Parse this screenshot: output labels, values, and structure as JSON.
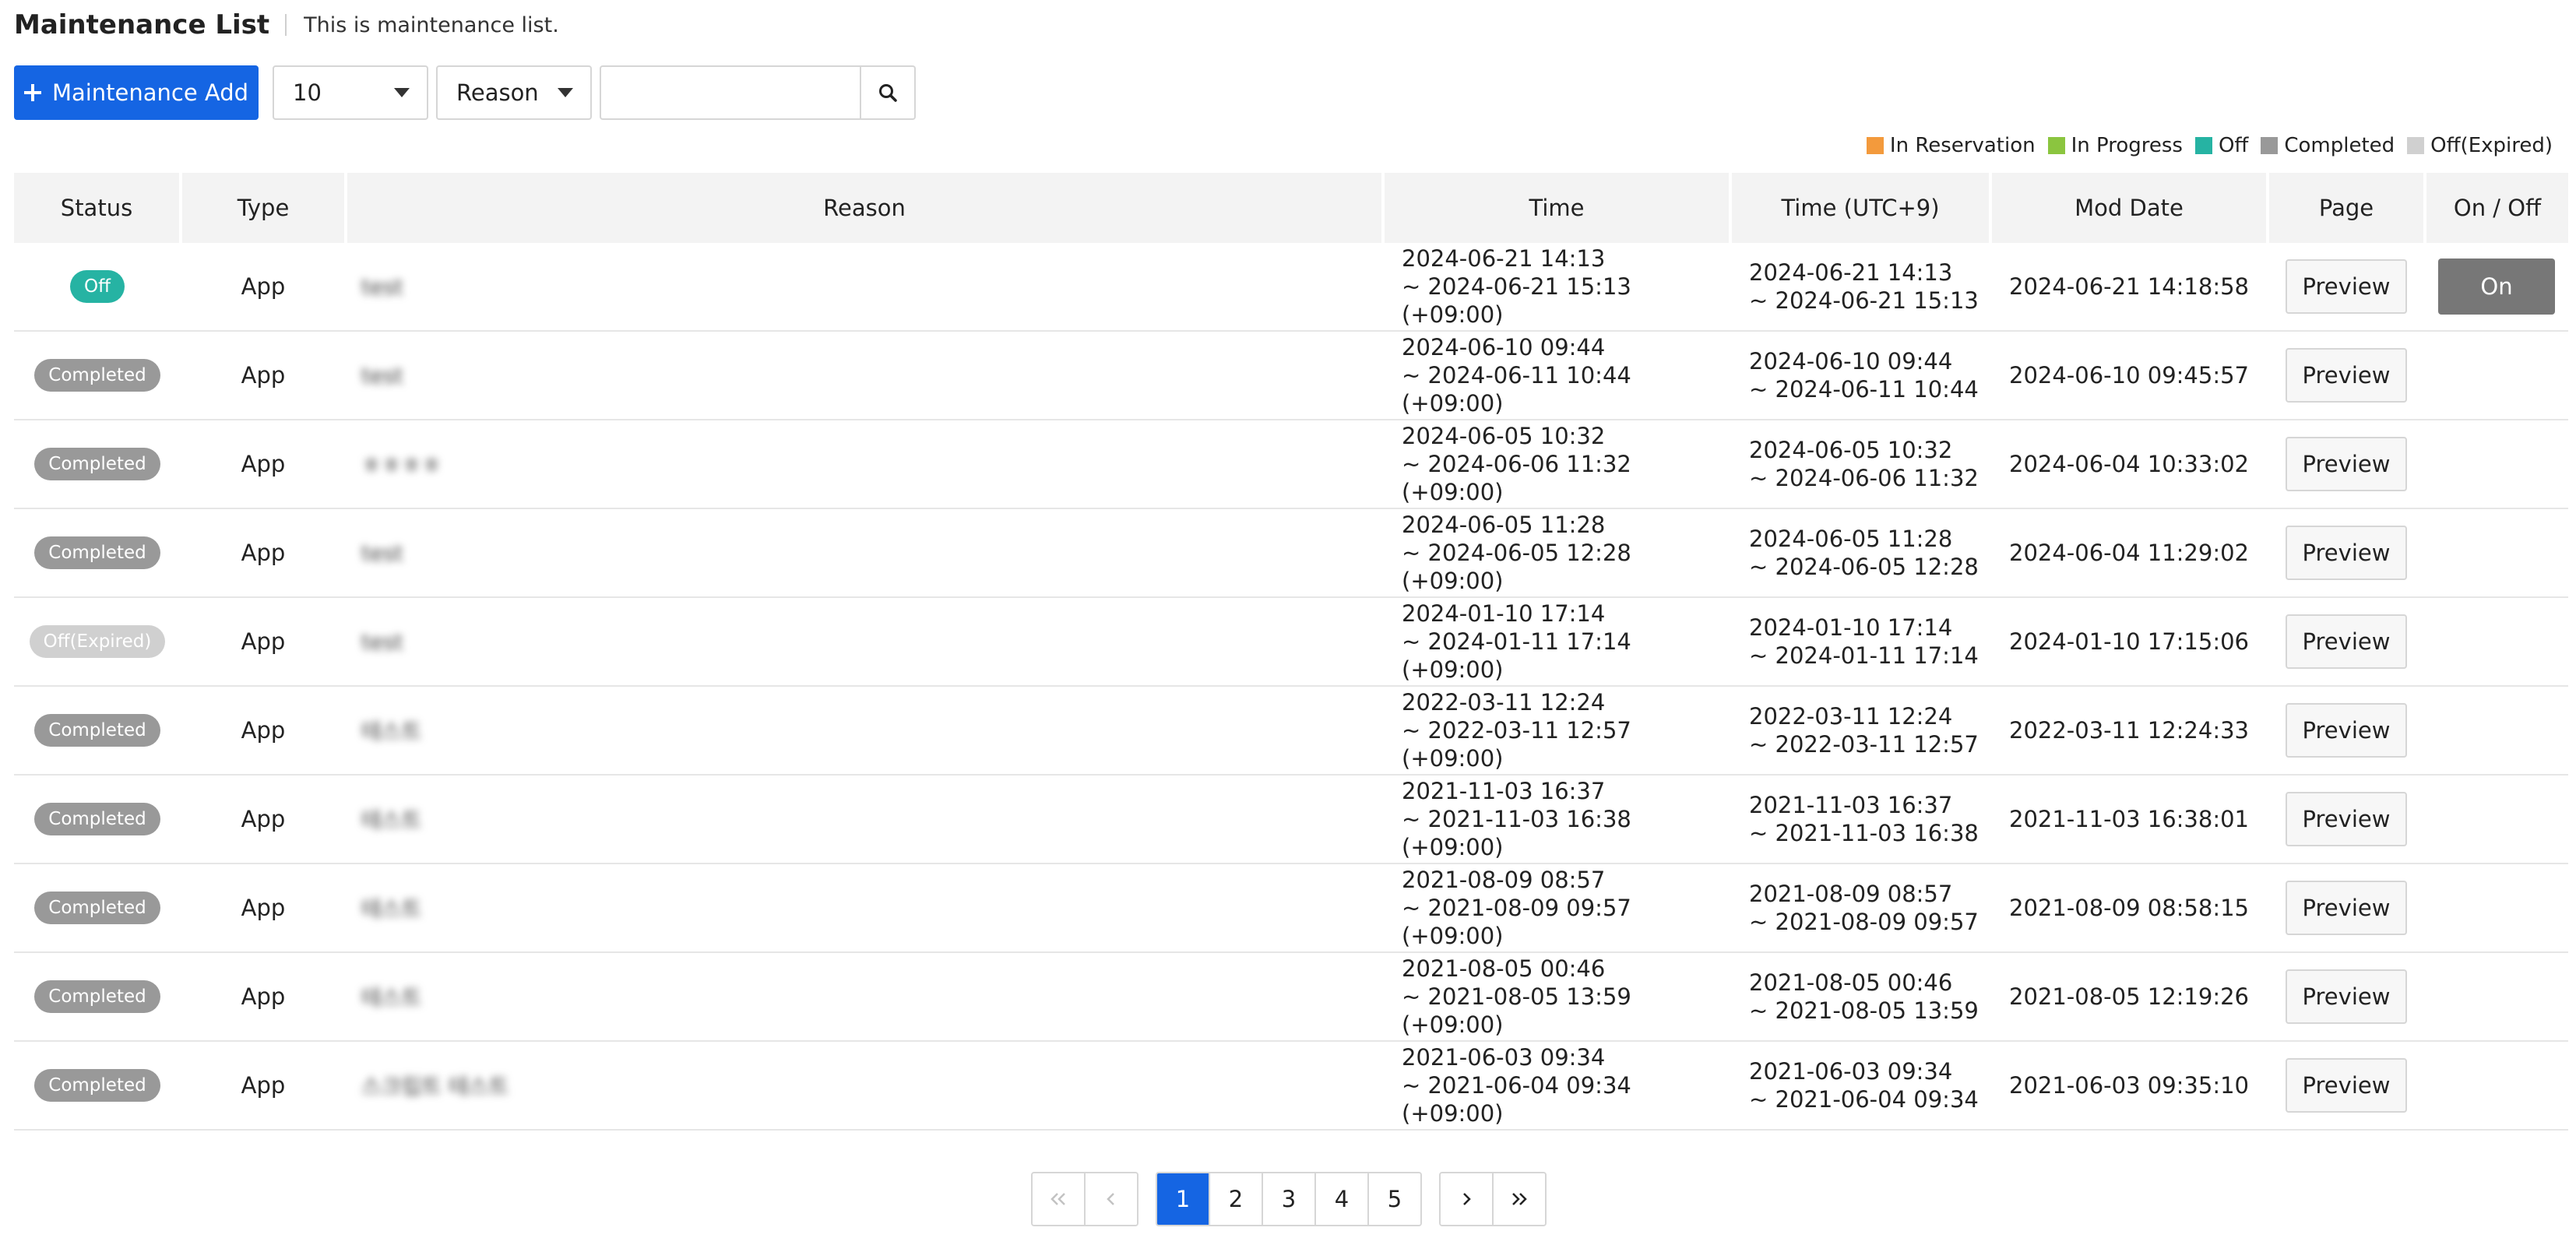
{
  "header": {
    "title": "Maintenance List",
    "description": "This is maintenance list."
  },
  "toolbar": {
    "add_label": "Maintenance Add",
    "page_size": "10",
    "search_field": "Reason",
    "search_value": "",
    "search_icon": "search-icon"
  },
  "legend": [
    {
      "label": "In Reservation",
      "color": "#f39a3c"
    },
    {
      "label": "In Progress",
      "color": "#8bc53f"
    },
    {
      "label": "Off",
      "color": "#26b3a3"
    },
    {
      "label": "Completed",
      "color": "#999999"
    },
    {
      "label": "Off(Expired)",
      "color": "#d0d0d0"
    }
  ],
  "table": {
    "headers": [
      "Status",
      "Type",
      "Reason",
      "Time",
      "Time (UTC+9)",
      "Mod Date",
      "Page",
      "On / Off"
    ],
    "rows": [
      {
        "status": "Off",
        "status_color": "#26b3a3",
        "type": "App",
        "reason": "test",
        "time_start": "2024-06-21 14:13",
        "time_end": "~ 2024-06-21 15:13 (+09:00)",
        "utc_start": "2024-06-21 14:13",
        "utc_end": "~ 2024-06-21 15:13",
        "mod_date": "2024-06-21 14:18:58",
        "page": "Preview",
        "toggle": "On"
      },
      {
        "status": "Completed",
        "status_color": "#999999",
        "type": "App",
        "reason": "test",
        "time_start": "2024-06-10 09:44",
        "time_end": "~ 2024-06-11 10:44 (+09:00)",
        "utc_start": "2024-06-10 09:44",
        "utc_end": "~ 2024-06-11 10:44",
        "mod_date": "2024-06-10 09:45:57",
        "page": "Preview",
        "toggle": ""
      },
      {
        "status": "Completed",
        "status_color": "#999999",
        "type": "App",
        "reason": "ㅎㅎㅎㅎ",
        "time_start": "2024-06-05 10:32",
        "time_end": "~ 2024-06-06 11:32 (+09:00)",
        "utc_start": "2024-06-05 10:32",
        "utc_end": "~ 2024-06-06 11:32",
        "mod_date": "2024-06-04 10:33:02",
        "page": "Preview",
        "toggle": ""
      },
      {
        "status": "Completed",
        "status_color": "#999999",
        "type": "App",
        "reason": "test",
        "time_start": "2024-06-05 11:28",
        "time_end": "~ 2024-06-05 12:28 (+09:00)",
        "utc_start": "2024-06-05 11:28",
        "utc_end": "~ 2024-06-05 12:28",
        "mod_date": "2024-06-04 11:29:02",
        "page": "Preview",
        "toggle": ""
      },
      {
        "status": "Off(Expired)",
        "status_color": "#d0d0d0",
        "type": "App",
        "reason": "test",
        "time_start": "2024-01-10 17:14",
        "time_end": "~ 2024-01-11 17:14 (+09:00)",
        "utc_start": "2024-01-10 17:14",
        "utc_end": "~ 2024-01-11 17:14",
        "mod_date": "2024-01-10 17:15:06",
        "page": "Preview",
        "toggle": ""
      },
      {
        "status": "Completed",
        "status_color": "#999999",
        "type": "App",
        "reason": "테스트",
        "time_start": "2022-03-11 12:24",
        "time_end": "~ 2022-03-11 12:57 (+09:00)",
        "utc_start": "2022-03-11 12:24",
        "utc_end": "~ 2022-03-11 12:57",
        "mod_date": "2022-03-11 12:24:33",
        "page": "Preview",
        "toggle": ""
      },
      {
        "status": "Completed",
        "status_color": "#999999",
        "type": "App",
        "reason": "테스트",
        "time_start": "2021-11-03 16:37",
        "time_end": "~ 2021-11-03 16:38 (+09:00)",
        "utc_start": "2021-11-03 16:37",
        "utc_end": "~ 2021-11-03 16:38",
        "mod_date": "2021-11-03 16:38:01",
        "page": "Preview",
        "toggle": ""
      },
      {
        "status": "Completed",
        "status_color": "#999999",
        "type": "App",
        "reason": "테스트",
        "time_start": "2021-08-09 08:57",
        "time_end": "~ 2021-08-09 09:57 (+09:00)",
        "utc_start": "2021-08-09 08:57",
        "utc_end": "~ 2021-08-09 09:57",
        "mod_date": "2021-08-09 08:58:15",
        "page": "Preview",
        "toggle": ""
      },
      {
        "status": "Completed",
        "status_color": "#999999",
        "type": "App",
        "reason": "테스트",
        "time_start": "2021-08-05 00:46",
        "time_end": "~ 2021-08-05 13:59 (+09:00)",
        "utc_start": "2021-08-05 00:46",
        "utc_end": "~ 2021-08-05 13:59",
        "mod_date": "2021-08-05 12:19:26",
        "page": "Preview",
        "toggle": ""
      },
      {
        "status": "Completed",
        "status_color": "#999999",
        "type": "App",
        "reason": "스크립트 테스트",
        "time_start": "2021-06-03 09:34",
        "time_end": "~ 2021-06-04 09:34 (+09:00)",
        "utc_start": "2021-06-03 09:34",
        "utc_end": "~ 2021-06-04 09:34",
        "mod_date": "2021-06-03 09:35:10",
        "page": "Preview",
        "toggle": ""
      }
    ]
  },
  "pagination": {
    "first_icon": "double-chevron-left-icon",
    "prev_icon": "chevron-left-icon",
    "pages": [
      "1",
      "2",
      "3",
      "4",
      "5"
    ],
    "current": "1",
    "next_icon": "chevron-right-icon",
    "last_icon": "double-chevron-right-icon"
  },
  "colors": {
    "accent": "#1565e3",
    "toggle": "#777777"
  }
}
